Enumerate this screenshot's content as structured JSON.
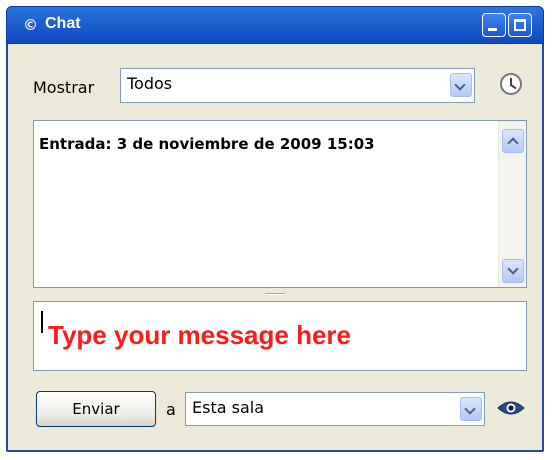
{
  "window": {
    "title": "Chat",
    "title_icon": "chat-icon",
    "minimize_icon": "minimize-icon",
    "maximize_icon": "maximize-icon",
    "colors": {
      "titlebar": "#1d5fcf",
      "frame": "#ece9d8",
      "placeholder": "#ff1a1a"
    }
  },
  "filter": {
    "label": "Mostrar",
    "selected": "Todos",
    "history_icon": "clock-icon"
  },
  "log": {
    "entries": [
      "Entrada: 3 de noviembre de 2009 15:03"
    ]
  },
  "composer": {
    "placeholder": "Type your message here"
  },
  "send": {
    "button_label": "Enviar",
    "to_label": "a",
    "recipient": "Esta sala",
    "visibility_icon": "eye-icon"
  }
}
